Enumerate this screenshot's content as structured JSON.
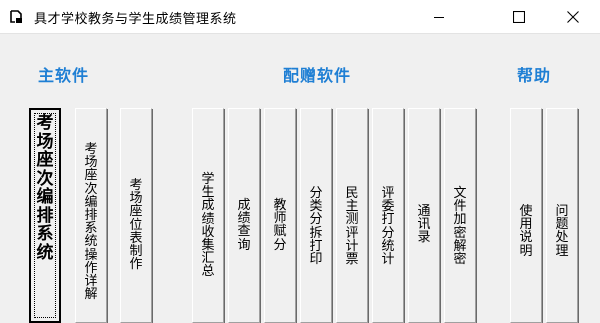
{
  "window": {
    "title": "具才学校教务与学生成绩管理系统",
    "controls": {
      "minimize": "minimize",
      "maximize": "maximize",
      "close": "close"
    }
  },
  "sections": {
    "main": "主软件",
    "bonus": "配赠软件",
    "help": "帮助"
  },
  "buttons": [
    {
      "label": "考场座次编排系统",
      "focused": true
    },
    {
      "label": "考场座次编排系统操作详解"
    },
    {
      "label": "考场座位表制作"
    },
    {
      "label": "学生成绩收集汇总"
    },
    {
      "label": "成绩查询"
    },
    {
      "label": "教师赋分"
    },
    {
      "label": "分类分拆打印"
    },
    {
      "label": "民主测评计票"
    },
    {
      "label": "评委打分统计"
    },
    {
      "label": "通讯录"
    },
    {
      "label": "文件加密解密"
    },
    {
      "label": "使用说明"
    },
    {
      "label": "问题处理"
    }
  ],
  "colors": {
    "section_title": "#1f7fd4",
    "background": "#f0f0f0"
  }
}
